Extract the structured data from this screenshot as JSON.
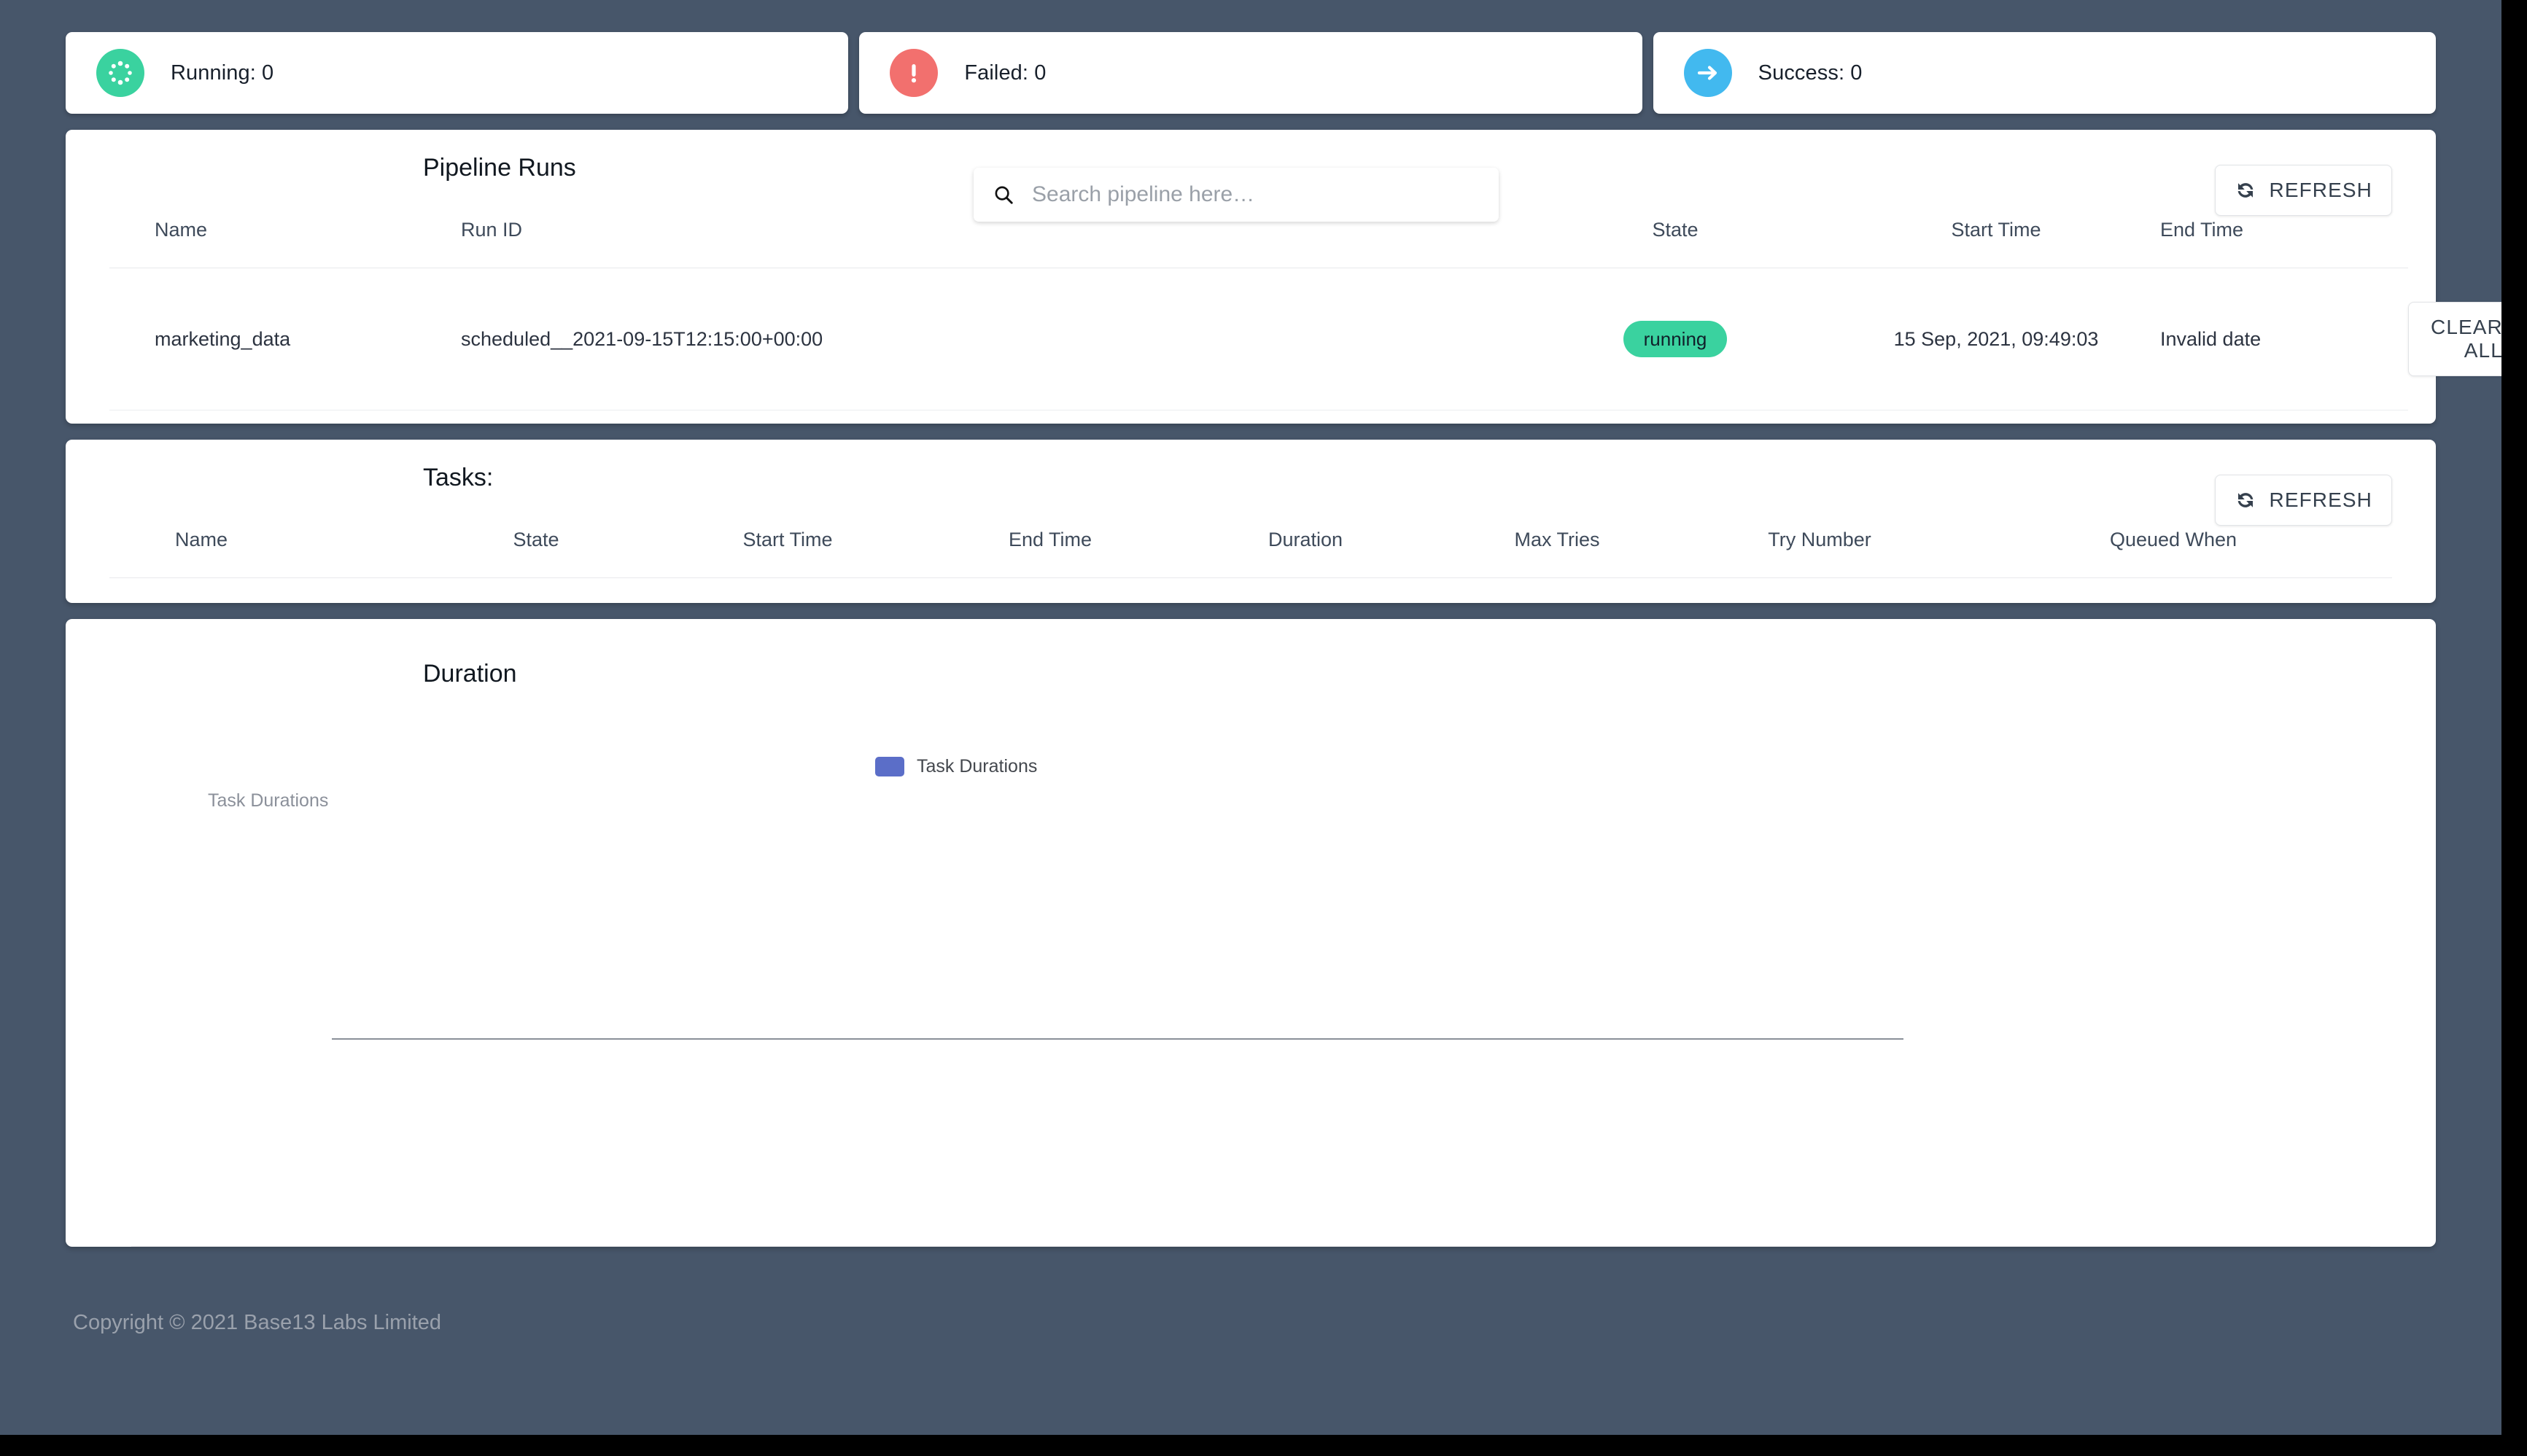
{
  "theme": {
    "background": "#47566a",
    "card_background": "#ffffff",
    "running_color": "#3ad29f",
    "failed_color": "#f2706e",
    "success_color": "#42b9ef",
    "badge_color": "#3ad29f",
    "legend_color": "#5b6ec8",
    "text_color": "#2c3340"
  },
  "status_cards": [
    {
      "icon": "spinner-icon",
      "label": "Running: 0",
      "name": "running",
      "color": "#3ad29f"
    },
    {
      "icon": "exclamation-icon",
      "label": "Failed: 0",
      "name": "failed",
      "color": "#f2706e"
    },
    {
      "icon": "arrow-right-icon",
      "label": "Success: 0",
      "name": "success",
      "color": "#42b9ef"
    }
  ],
  "pipeline_runs": {
    "title": "Pipeline Runs",
    "search": {
      "placeholder": "Search pipeline here…",
      "value": "",
      "icon": "search-icon"
    },
    "refresh_label": "REFRESH",
    "refresh_icon": "sync-icon",
    "columns": [
      "Name",
      "Run ID",
      "State",
      "Start Time",
      "End Time",
      ""
    ],
    "rows": [
      {
        "name": "marketing_data",
        "run_id": "scheduled__2021-09-15T12:15:00+00:00",
        "state": "running",
        "start_time": "15 Sep, 2021, 09:49:03",
        "end_time": "Invalid date",
        "action_label": "CLEAR ALL"
      }
    ]
  },
  "tasks": {
    "title": "Tasks:",
    "refresh_label": "REFRESH",
    "refresh_icon": "sync-icon",
    "columns": [
      "Name",
      "State",
      "Start Time",
      "End Time",
      "Duration",
      "Max Tries",
      "Try Number",
      "Queued When"
    ],
    "rows": []
  },
  "duration": {
    "title": "Duration"
  },
  "chart_data": {
    "type": "bar",
    "title": "Duration",
    "xlabel": "",
    "ylabel": "Task Durations",
    "categories": [],
    "series": [
      {
        "name": "Task Durations",
        "values": [],
        "color": "#5b6ec8"
      }
    ],
    "legend": [
      "Task Durations"
    ],
    "legend_position": "top-center",
    "grid": false,
    "empty": true
  },
  "footer": {
    "copyright": "Copyright © 2021 Base13 Labs Limited"
  }
}
